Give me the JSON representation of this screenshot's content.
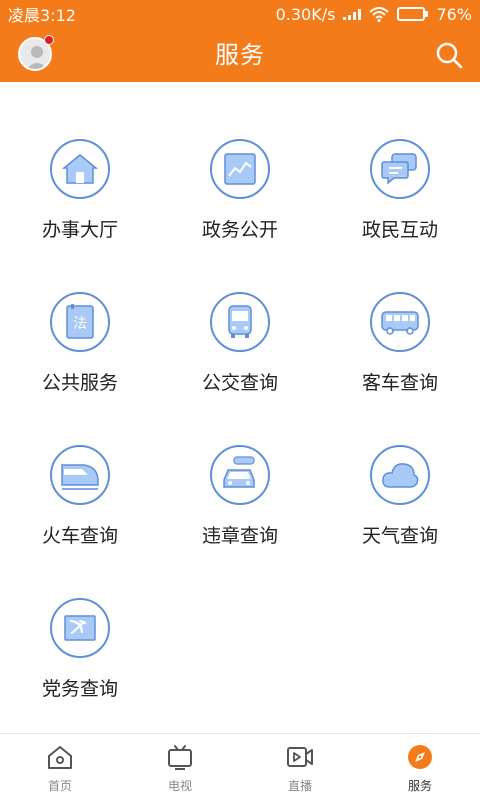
{
  "status_bar": {
    "time": "凌晨3:12",
    "network_speed": "0.30K/s",
    "battery": "76%",
    "battery_level": 0.76
  },
  "header": {
    "title": "服务",
    "avatar_icon": "user-avatar-icon",
    "search_icon": "search-icon"
  },
  "services": [
    {
      "label": "办事大厅",
      "icon": "house-icon"
    },
    {
      "label": "政务公开",
      "icon": "trend-chart-icon"
    },
    {
      "label": "政民互动",
      "icon": "chat-bubbles-icon"
    },
    {
      "label": "公共服务",
      "icon": "law-book-icon"
    },
    {
      "label": "公交查询",
      "icon": "bus-front-icon"
    },
    {
      "label": "客车查询",
      "icon": "coach-bus-icon"
    },
    {
      "label": "火车查询",
      "icon": "train-icon"
    },
    {
      "label": "违章查询",
      "icon": "car-icon"
    },
    {
      "label": "天气查询",
      "icon": "cloud-icon"
    },
    {
      "label": "党务查询",
      "icon": "party-flag-icon"
    }
  ],
  "tabs": [
    {
      "label": "首页",
      "icon": "home-icon",
      "active": false
    },
    {
      "label": "电视",
      "icon": "tv-icon",
      "active": false
    },
    {
      "label": "直播",
      "icon": "live-video-icon",
      "active": false
    },
    {
      "label": "服务",
      "icon": "compass-icon",
      "active": true
    }
  ],
  "colors": {
    "brand_orange": "#f47b1a",
    "icon_blue": "#5e8fd8",
    "icon_fill": "#a9c9f6",
    "party_red": "#e02020"
  }
}
